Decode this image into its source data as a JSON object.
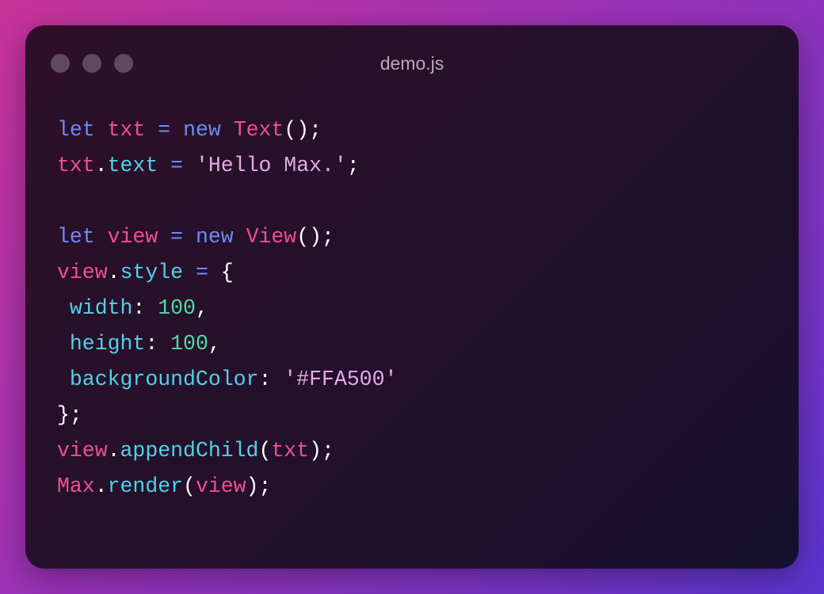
{
  "window": {
    "title": "demo.js",
    "controls": [
      "close",
      "minimize",
      "maximize"
    ]
  },
  "colors": {
    "keyword": "#6c8cf5",
    "identifier": "#f0508f",
    "property": "#4fd2e6",
    "string": "#e6a9e6",
    "number": "#4fdca4",
    "punctuation": "#ffffff"
  },
  "code": {
    "lines": [
      [
        [
          "kw",
          "let"
        ],
        [
          "pun",
          " "
        ],
        [
          "var",
          "txt"
        ],
        [
          "pun",
          " "
        ],
        [
          "kw",
          "="
        ],
        [
          "pun",
          " "
        ],
        [
          "kw",
          "new"
        ],
        [
          "pun",
          " "
        ],
        [
          "cls",
          "Text"
        ],
        [
          "pun",
          "();"
        ]
      ],
      [
        [
          "var",
          "txt"
        ],
        [
          "pun",
          "."
        ],
        [
          "prop",
          "text"
        ],
        [
          "pun",
          " "
        ],
        [
          "kw",
          "="
        ],
        [
          "pun",
          " "
        ],
        [
          "str",
          "'Hello Max.'"
        ],
        [
          "pun",
          ";"
        ]
      ],
      [],
      [
        [
          "kw",
          "let"
        ],
        [
          "pun",
          " "
        ],
        [
          "var",
          "view"
        ],
        [
          "pun",
          " "
        ],
        [
          "kw",
          "="
        ],
        [
          "pun",
          " "
        ],
        [
          "kw",
          "new"
        ],
        [
          "pun",
          " "
        ],
        [
          "cls",
          "View"
        ],
        [
          "pun",
          "();"
        ]
      ],
      [
        [
          "var",
          "view"
        ],
        [
          "pun",
          "."
        ],
        [
          "prop",
          "style"
        ],
        [
          "pun",
          " "
        ],
        [
          "kw",
          "="
        ],
        [
          "pun",
          " {"
        ]
      ],
      [
        [
          "pun",
          " "
        ],
        [
          "prop",
          "width"
        ],
        [
          "pun",
          ": "
        ],
        [
          "num",
          "100"
        ],
        [
          "pun",
          ","
        ]
      ],
      [
        [
          "pun",
          " "
        ],
        [
          "prop",
          "height"
        ],
        [
          "pun",
          ": "
        ],
        [
          "num",
          "100"
        ],
        [
          "pun",
          ","
        ]
      ],
      [
        [
          "pun",
          " "
        ],
        [
          "prop",
          "backgroundColor"
        ],
        [
          "pun",
          ": "
        ],
        [
          "str",
          "'#FFA500'"
        ]
      ],
      [
        [
          "pun",
          "};"
        ]
      ],
      [
        [
          "var",
          "view"
        ],
        [
          "pun",
          "."
        ],
        [
          "prop",
          "appendChild"
        ],
        [
          "pun",
          "("
        ],
        [
          "var",
          "txt"
        ],
        [
          "pun",
          ");"
        ]
      ],
      [
        [
          "cls",
          "Max"
        ],
        [
          "pun",
          "."
        ],
        [
          "prop",
          "render"
        ],
        [
          "pun",
          "("
        ],
        [
          "var",
          "view"
        ],
        [
          "pun",
          ");"
        ]
      ]
    ]
  }
}
